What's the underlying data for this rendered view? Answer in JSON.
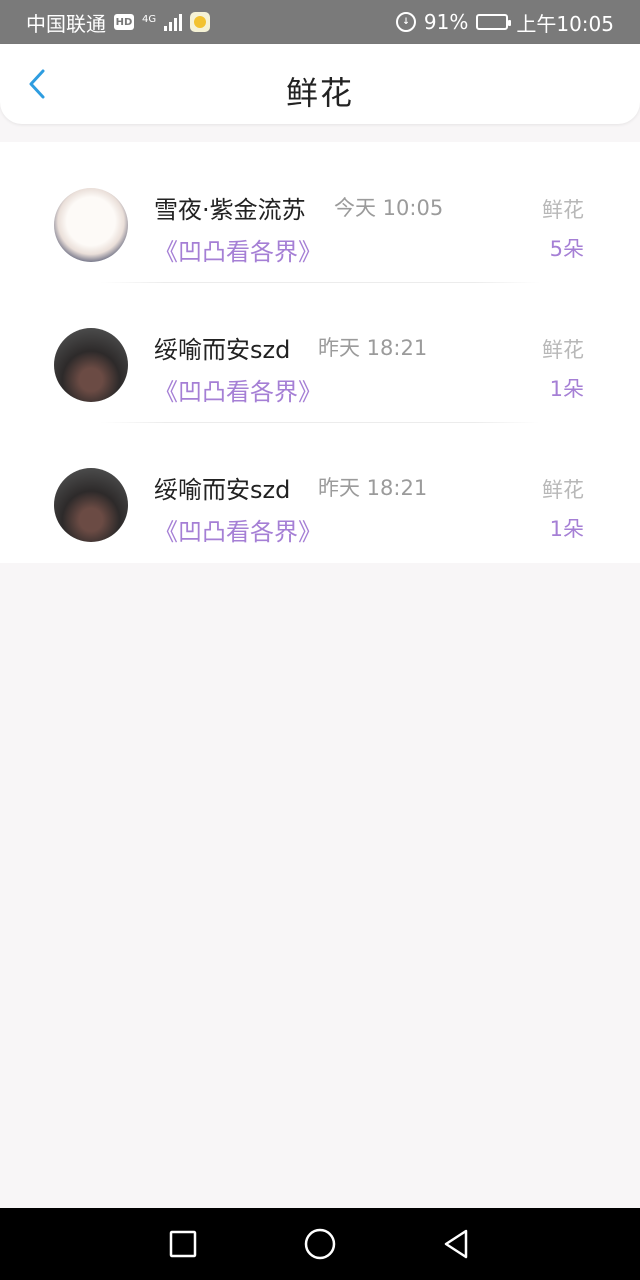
{
  "status_bar": {
    "carrier": "中国联通",
    "hd_badge": "HD",
    "network": "4G",
    "battery_percent": "91%",
    "battery_level": 0.91,
    "time": "上午10:05"
  },
  "header": {
    "title": "鲜花",
    "back_icon": "chevron-left-icon",
    "accent": "#2e9de0"
  },
  "gifts": [
    {
      "name": "雪夜·紫金流苏",
      "time": "今天 10:05",
      "book": "《凹凸看各界》",
      "type": "鲜花",
      "count": "5朵",
      "avatar": "cat-avatar"
    },
    {
      "name": "绥喻而安szd",
      "time": "昨天 18:21",
      "book": "《凹凸看各界》",
      "type": "鲜花",
      "count": "1朵",
      "avatar": "dark-photo-avatar"
    },
    {
      "name": "绥喻而安szd",
      "time": "昨天 18:21",
      "book": "《凹凸看各界》",
      "type": "鲜花",
      "count": "1朵",
      "avatar": "dark-photo-avatar"
    }
  ],
  "colors": {
    "highlight": "#a57fd5",
    "muted": "#9b9b9b"
  },
  "nav_bar": {
    "recent_icon": "square-icon",
    "home_icon": "circle-icon",
    "back_icon": "triangle-back-icon"
  }
}
